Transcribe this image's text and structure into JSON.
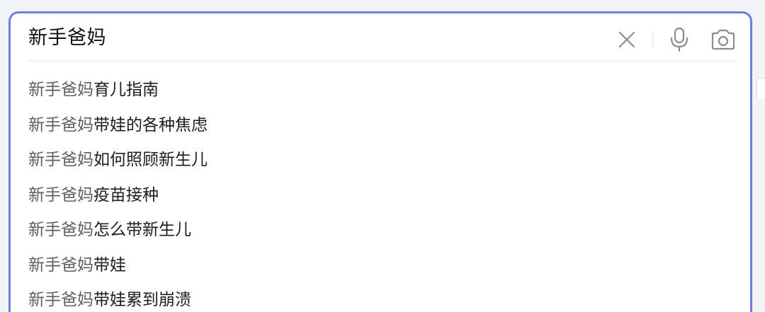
{
  "search": {
    "query": "新手爸妈",
    "clear_icon": "close-icon",
    "voice_icon": "microphone-icon",
    "image_search_icon": "camera-icon"
  },
  "suggestions": [
    {
      "prefix": "新手爸妈",
      "rest": "育儿指南"
    },
    {
      "prefix": "新手爸妈",
      "rest": "带娃的各种焦虑"
    },
    {
      "prefix": "新手爸妈",
      "rest": "如何照顾新生儿"
    },
    {
      "prefix": "新手爸妈",
      "rest": "疫苗接种"
    },
    {
      "prefix": "新手爸妈",
      "rest": "怎么带新生儿"
    },
    {
      "prefix": "新手爸妈",
      "rest": "带娃"
    },
    {
      "prefix": "新手爸妈",
      "rest": "带娃累到崩溃"
    }
  ],
  "colors": {
    "accent_border": "#6a7fe0",
    "icon": "#8a8c94"
  }
}
